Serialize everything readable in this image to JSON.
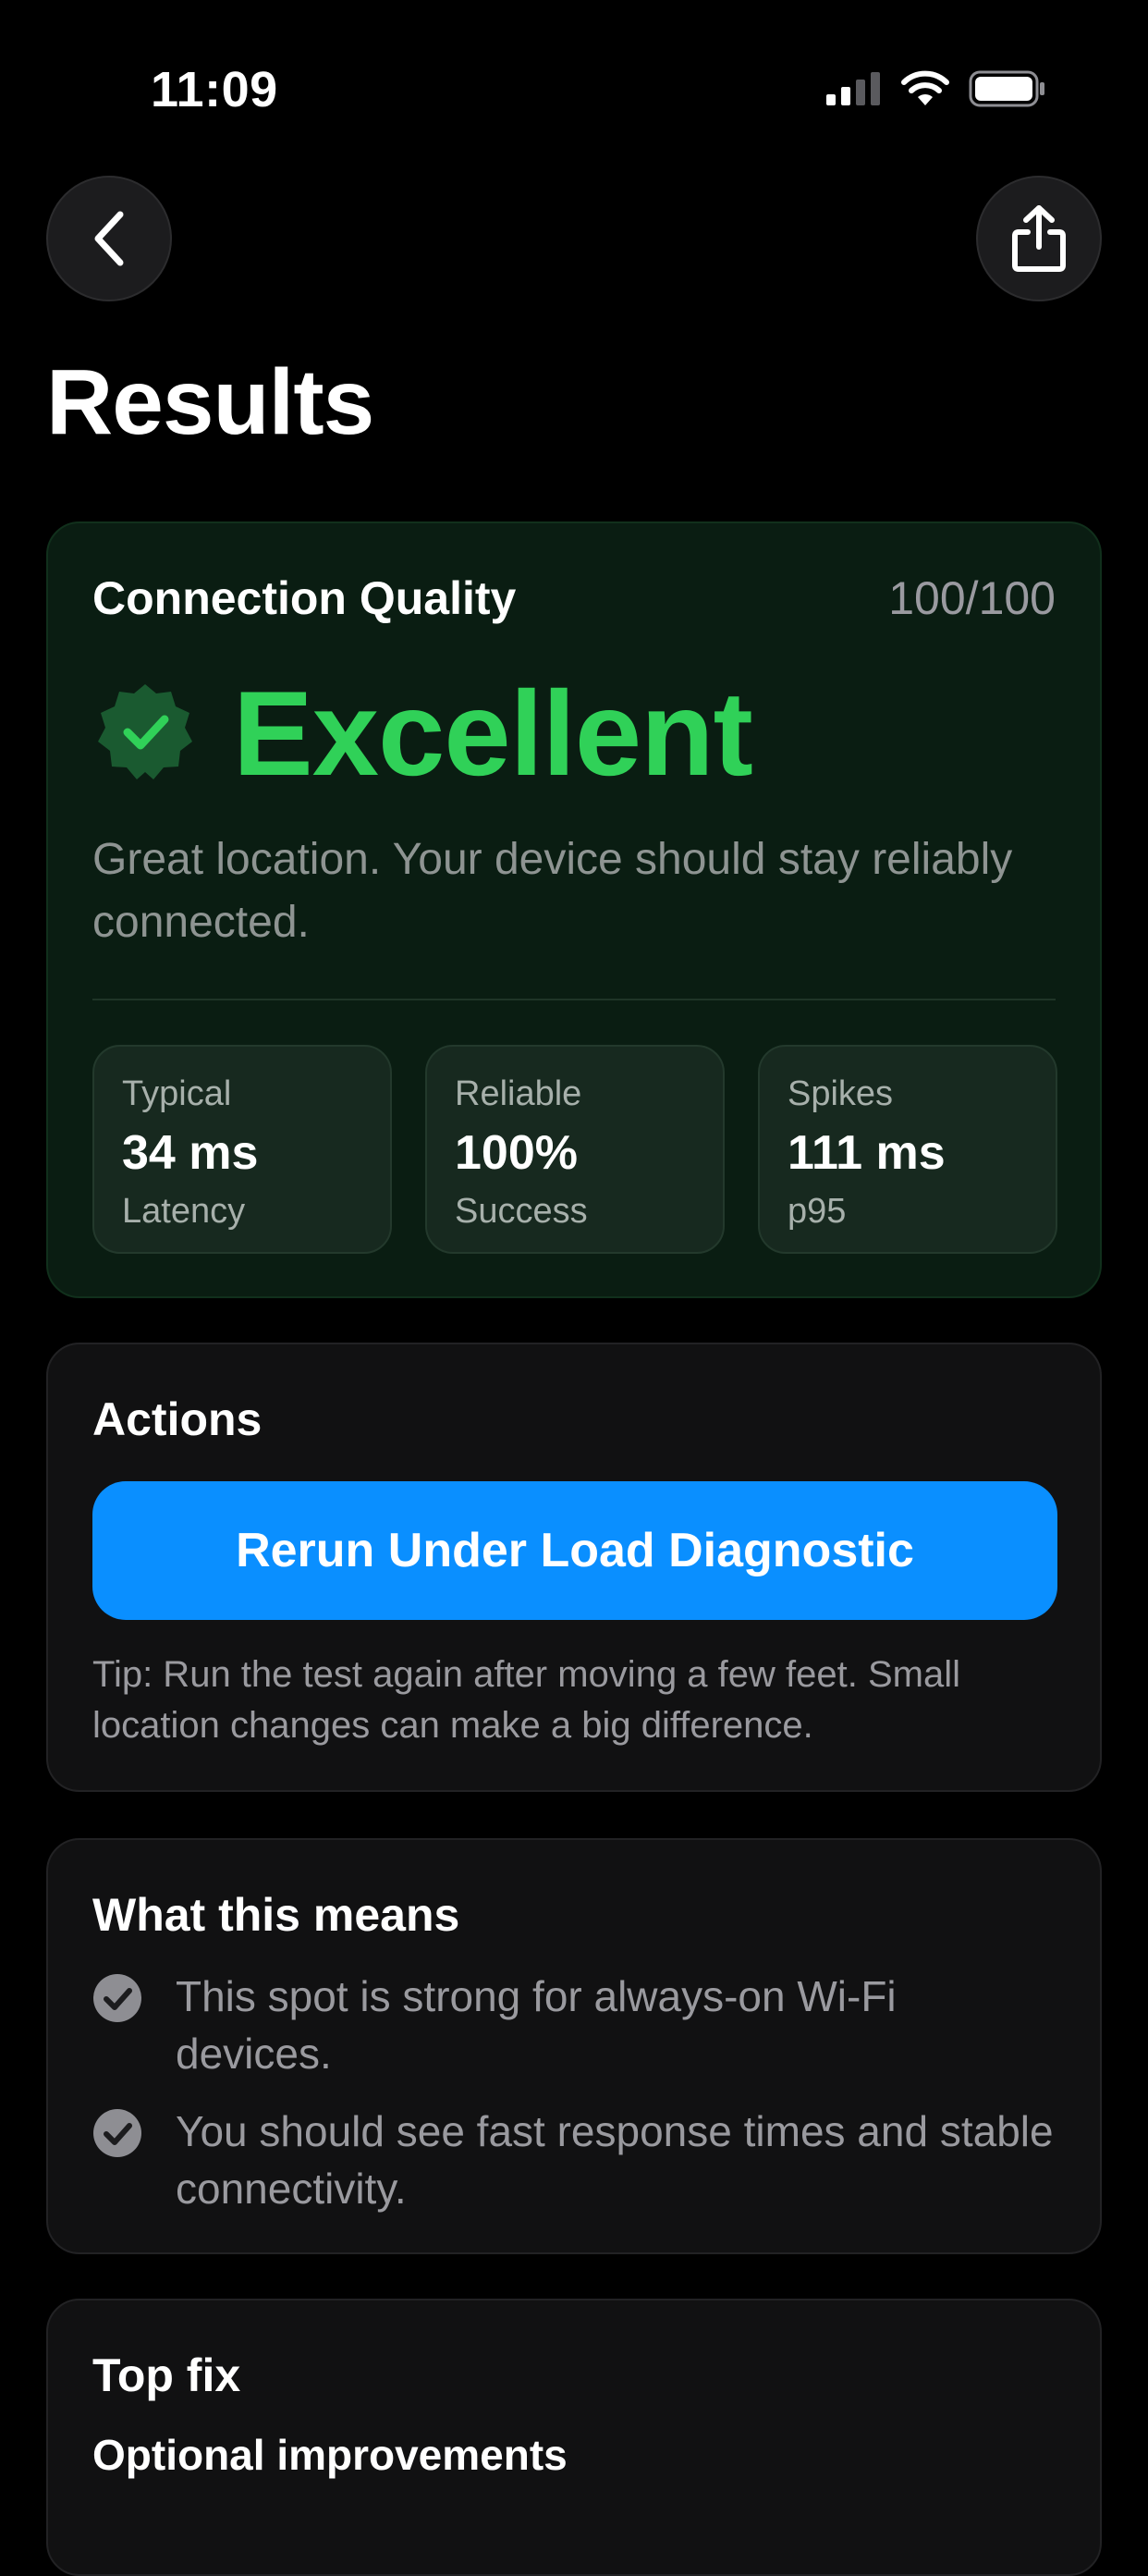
{
  "status_bar": {
    "time": "11:09"
  },
  "header": {
    "title": "Results"
  },
  "quality": {
    "heading": "Connection Quality",
    "score": "100/100",
    "rating": "Excellent",
    "description": "Great location. Your device should stay reliably connected.",
    "metrics": [
      {
        "top": "Typical",
        "value": "34 ms",
        "bottom": "Latency"
      },
      {
        "top": "Reliable",
        "value": "100%",
        "bottom": "Success"
      },
      {
        "top": "Spikes",
        "value": "111 ms",
        "bottom": "p95"
      }
    ]
  },
  "actions": {
    "heading": "Actions",
    "button_label": "Rerun Under Load Diagnostic",
    "tip": "Tip: Run the test again after moving a few feet. Small location changes can make a big difference."
  },
  "means": {
    "heading": "What this means",
    "items": [
      "This spot is strong for always-on Wi-Fi devices.",
      "You should see fast response times and stable connectivity."
    ]
  },
  "top_fix": {
    "heading": "Top fix",
    "subheading": "Optional improvements"
  },
  "colors": {
    "accent_blue": "#0a8fff",
    "success_green": "#30d158",
    "background": "#000000"
  },
  "icons": [
    "back-chevron-icon",
    "share-icon",
    "verified-badge-icon",
    "check-circle-icon",
    "signal-icon",
    "wifi-icon",
    "battery-icon"
  ]
}
